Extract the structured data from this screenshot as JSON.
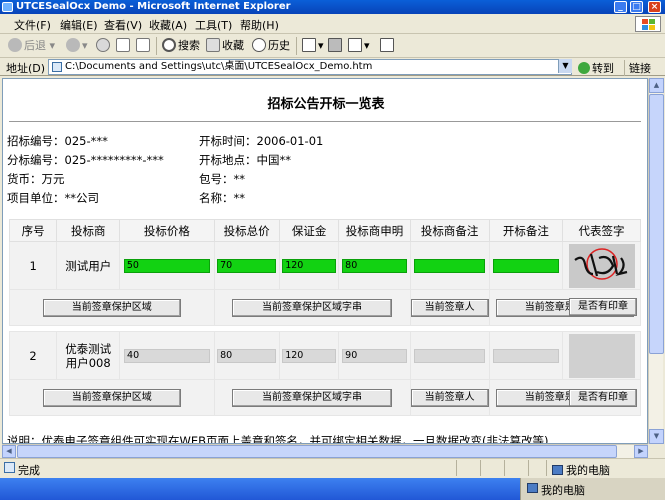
{
  "window": {
    "title": "UTCESealOcx Demo - Microsoft Internet Explorer"
  },
  "menu": [
    "文件(F)",
    "编辑(E)",
    "查看(V)",
    "收藏(A)",
    "工具(T)",
    "帮助(H)"
  ],
  "toolbar": {
    "back": "后退",
    "search": "搜索",
    "favorites": "收藏",
    "history": "历史"
  },
  "address": {
    "label": "地址(D)",
    "value": "C:\\Documents and Settings\\utc\\桌面\\UTCESealOcx_Demo.htm",
    "go": "转到",
    "links": "链接"
  },
  "page": {
    "title": "招标公告开标一览表",
    "info_left": [
      "招标编号：025-***",
      "分标编号：025-*********-***",
      "货币：万元",
      "项目单位：**公司"
    ],
    "info_right": [
      "开标时间：2006-01-01",
      "开标地点：中国**",
      "包号：**",
      "名称：**"
    ],
    "columns": [
      "序号",
      "投标商",
      "投标价格",
      "投标总价",
      "保证金",
      "投标商申明",
      "投标商备注",
      "开标备注",
      "代表签字"
    ],
    "rows": [
      {
        "no": "1",
        "bidder": "测试用户",
        "price": "50",
        "total": "70",
        "deposit": "120",
        "declare": "80",
        "note1": "",
        "note2": "",
        "note3": ""
      },
      {
        "no": "2",
        "bidder": "优泰测试用户008",
        "price": "40",
        "total": "80",
        "deposit": "120",
        "declare": "90",
        "note1": "",
        "note2": "",
        "note3": ""
      }
    ],
    "buttons": [
      "当前签章保护区域",
      "当前签章保护区域字串",
      "当前签章人",
      "当前签章是否有效",
      "是否有印章"
    ],
    "note": "说明：优泰电子签章组件可实现在WEB页面上盖章和签名，并可绑定相关数据，一旦数据改变(非法篡改等)"
  },
  "status": {
    "text": "完成",
    "zone": "我的电脑"
  },
  "tray": {
    "text": "我的电脑"
  },
  "colors": {
    "filled": "#12d212",
    "empty": "#d9d9d9",
    "titlebar": "#0a5fd8"
  }
}
